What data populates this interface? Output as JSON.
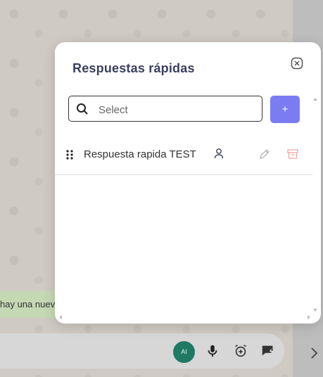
{
  "chat": {
    "bubble_text": "hay una nueva"
  },
  "composer": {
    "ai_label": "AI",
    "icons": [
      "mic-icon",
      "alarm-add-icon",
      "quick-reply-icon",
      "chevron-right-icon"
    ]
  },
  "modal": {
    "title": "Respuestas rápidas",
    "search_placeholder": "Select",
    "add_label": "+",
    "items": [
      {
        "label": "Respuesta rapida TEST"
      }
    ]
  },
  "colors": {
    "accent": "#7b7cf2",
    "title": "#3b3f5e",
    "archive": "#f2a4a4",
    "ai": "#1f7a64"
  }
}
